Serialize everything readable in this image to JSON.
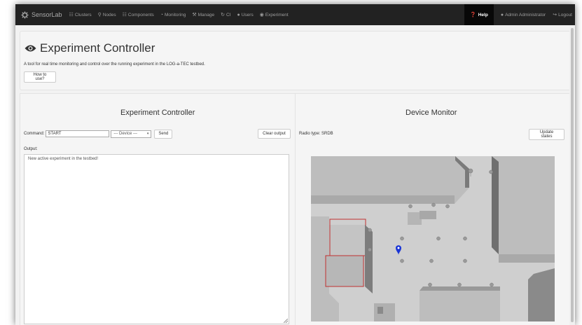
{
  "navbar": {
    "brand": "SensorLab",
    "items": [
      {
        "label": "Clusters",
        "icon": "grid-icon"
      },
      {
        "label": "Nodes",
        "icon": "map-marker-icon"
      },
      {
        "label": "Components",
        "icon": "grid-icon"
      },
      {
        "label": "Monitoring",
        "icon": "dashboard-icon"
      },
      {
        "label": "Manage",
        "icon": "wrench-icon"
      },
      {
        "label": "CI",
        "icon": "refresh-icon"
      },
      {
        "label": "Users",
        "icon": "user-icon"
      },
      {
        "label": "Experiment",
        "icon": "eye-icon"
      }
    ],
    "help": "Help",
    "admin": "Admin Administrator",
    "logout": "Logout"
  },
  "header": {
    "title": "Experiment Controller",
    "subtitle": "A tool for real time monitoring and control over the running experiment in the LOG-a-TEC testbed.",
    "howto": "How to use?"
  },
  "controller": {
    "title": "Experiment Controller",
    "command_label": "Command:",
    "command_value": "START",
    "device_select": "--- Device ---",
    "send": "Send",
    "clear": "Clear output",
    "output_label": "Output:",
    "output_text": "New active experiment in the testbed!"
  },
  "monitor": {
    "title": "Device Monitor",
    "radio_type": "Radio type: SRDB",
    "update": "Update states"
  },
  "colors": {
    "navbar": "#222222",
    "selected_node": "#1a35d6",
    "highlight_building": "#c03030"
  }
}
